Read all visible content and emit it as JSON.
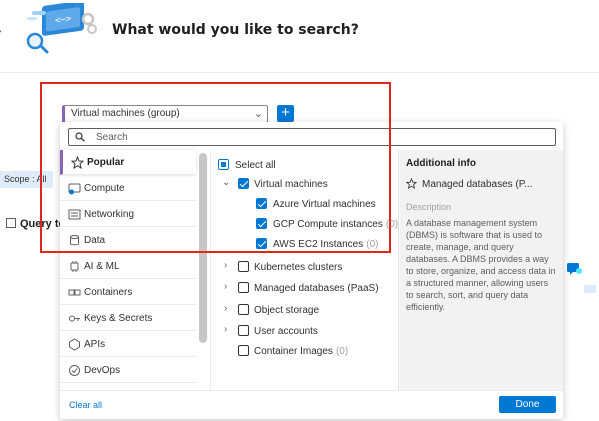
{
  "header": {
    "title": "What would you like to search?"
  },
  "background": {
    "scope_label": "Scope : All",
    "query_label": "Query ter"
  },
  "selector": {
    "value": "Virtual machines (group)",
    "add_label": "+"
  },
  "search": {
    "placeholder": "Search"
  },
  "categories": [
    {
      "label": "Popular",
      "icon": "star-icon",
      "active": true
    },
    {
      "label": "Compute",
      "icon": "compute-icon"
    },
    {
      "label": "Networking",
      "icon": "networking-icon"
    },
    {
      "label": "Data",
      "icon": "database-icon"
    },
    {
      "label": "AI & ML",
      "icon": "ai-ml-icon"
    },
    {
      "label": "Containers",
      "icon": "containers-icon"
    },
    {
      "label": "Keys & Secrets",
      "icon": "key-icon"
    },
    {
      "label": "APIs",
      "icon": "api-icon"
    },
    {
      "label": "DevOps",
      "icon": "devops-icon"
    }
  ],
  "tree": {
    "select_all": "Select all",
    "items": [
      {
        "label": "Virtual machines",
        "checked": true,
        "expanded": true
      },
      {
        "label": "Azure Virtual machines",
        "checked": true
      },
      {
        "label": "GCP Compute instances",
        "count": "(0)",
        "checked": true
      },
      {
        "label": "AWS EC2 Instances",
        "count": "(0)",
        "checked": true
      },
      {
        "label": "Kubernetes clusters",
        "checked": false
      },
      {
        "label": "Managed databases (PaaS)",
        "checked": false
      },
      {
        "label": "Object storage",
        "checked": false
      },
      {
        "label": "User accounts",
        "checked": false
      },
      {
        "label": "Container Images",
        "count": "(0)",
        "checked": false
      }
    ]
  },
  "info": {
    "heading": "Additional info",
    "item": "Managed databases (P...",
    "description_label": "Description",
    "description": "A database management system (DBMS) is software that is used to create, manage, and query databases. A DBMS provides a way to store, organize, and access data in a structured manner, allowing users to search, sort, and query data efficiently."
  },
  "footer": {
    "clear_all": "Clear all",
    "done": "Done"
  },
  "colors": {
    "accent": "#0078d4",
    "active_marker": "#8764b8",
    "highlight": "#e0271c"
  }
}
